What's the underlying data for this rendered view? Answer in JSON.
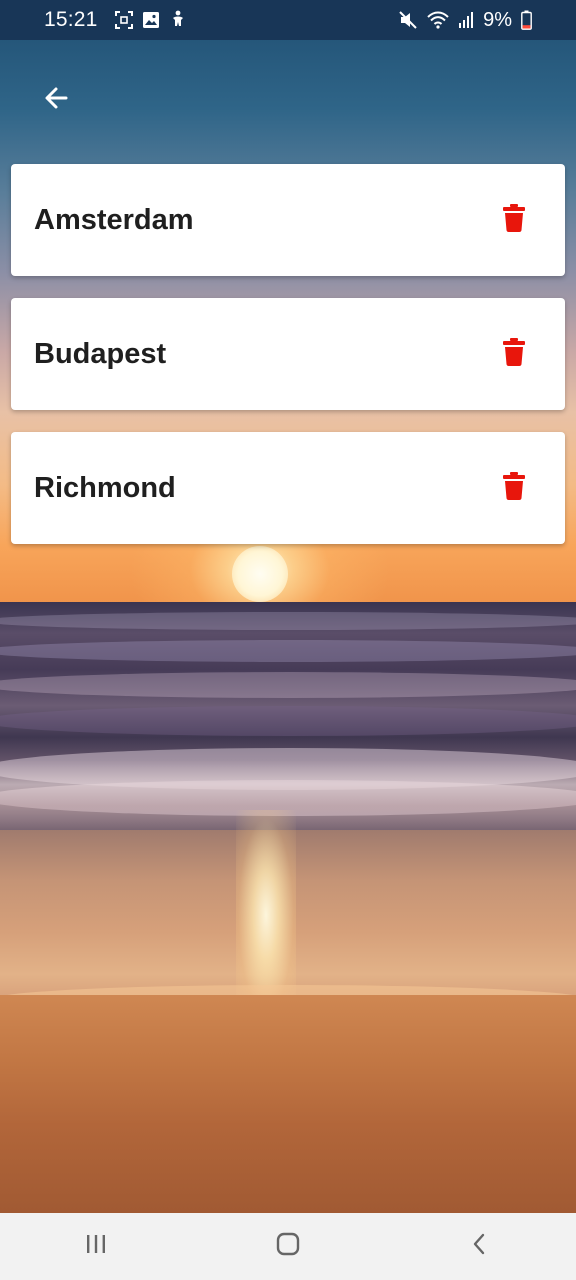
{
  "status_bar": {
    "time": "15:21",
    "battery_percent": "9%",
    "left_icons": [
      "screenshot-icon",
      "gallery-icon",
      "accessibility-icon"
    ],
    "right_icons": [
      "mute-icon",
      "wifi-icon",
      "signal-icon",
      "battery-low-icon"
    ]
  },
  "header": {
    "back_icon": "back-arrow-icon"
  },
  "cities": [
    {
      "name": "Amsterdam",
      "action_icon": "trash-icon"
    },
    {
      "name": "Budapest",
      "action_icon": "trash-icon"
    },
    {
      "name": "Richmond",
      "action_icon": "trash-icon"
    }
  ],
  "nav_bar": {
    "buttons": [
      "recent-apps-icon",
      "home-icon",
      "back-icon"
    ]
  },
  "colors": {
    "status_bar_bg": "#183657",
    "delete_icon": "#e8160c",
    "card_bg": "#ffffff",
    "city_text": "#1f1f1f",
    "nav_bar_bg": "#f2f2f2"
  }
}
